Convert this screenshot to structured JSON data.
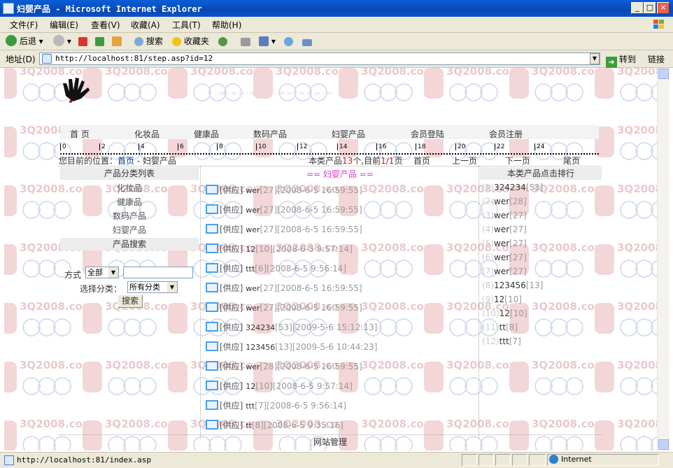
{
  "window": {
    "title": "妇婴产品 - Microsoft Internet Explorer",
    "min": "_",
    "max": "□",
    "close": "×"
  },
  "menu": [
    "文件(F)",
    "编辑(E)",
    "查看(V)",
    "收藏(A)",
    "工具(T)",
    "帮助(H)"
  ],
  "toolbar": {
    "back": "后退",
    "search": "搜索",
    "favorites": "收藏夹"
  },
  "address": {
    "label": "地址(D)",
    "url": "http://localhost:81/step.asp?id=12",
    "go": "转到",
    "links": "链接"
  },
  "watermark": "3Q2008.com",
  "nav": [
    "首 页",
    "化妆品",
    "健康品",
    "数码产品",
    "妇婴产品",
    "会员登陆",
    "会员注册"
  ],
  "ruler": [
    "0",
    "2",
    "4",
    "6",
    "8",
    "10",
    "12",
    "14",
    "16",
    "18",
    "20",
    "22",
    "24"
  ],
  "location": {
    "prefix": "您目前的位置：",
    "home": "首页",
    "current": " - 妇婴产品"
  },
  "pager": {
    "p1": "本类产品",
    "count": "13",
    "p2": "个,目前",
    "page": "1/1",
    "p3": "页",
    "first": "首页",
    "prev": "上一页",
    "next": "下一页",
    "last": "尾页"
  },
  "sidebar": {
    "title": "产品分类列表",
    "items": [
      "化妆品",
      "健康品",
      "数码产品",
      "妇婴产品"
    ],
    "search_title": "产品搜索",
    "mode_label": "方式",
    "mode_value": "全部",
    "category_label": "选择分类：",
    "category_value": "所有分类",
    "search_button": "搜索"
  },
  "main": {
    "title": "== 妇婴产品 ==",
    "rows": [
      {
        "tag": "[供应]",
        "name": "wer",
        "count": "27",
        "date": "2008-6-5 16:59:55"
      },
      {
        "tag": "[供应]",
        "name": "wer",
        "count": "27",
        "date": "2008-6-5 16:59:55"
      },
      {
        "tag": "[供应]",
        "name": "wer",
        "count": "27",
        "date": "2008-6-5 16:59:55"
      },
      {
        "tag": "[供应]",
        "name": "12",
        "count": "10",
        "date": "2008-6-5 9:57:14"
      },
      {
        "tag": "[供应]",
        "name": "ttt",
        "count": "6",
        "date": "2008-6-5 9:56:14"
      },
      {
        "tag": "[供应]",
        "name": "wer",
        "count": "27",
        "date": "2008-6-5 16:59:55"
      },
      {
        "tag": "[供应]",
        "name": "wer",
        "count": "27",
        "date": "2008-6-5 16:59:55"
      },
      {
        "tag": "[供应]",
        "name": "324234",
        "count": "53",
        "date": "2009-5-6 15:12:13"
      },
      {
        "tag": "[供应]",
        "name": "123456",
        "count": "13",
        "date": "2009-5-6 10:44:23"
      },
      {
        "tag": "[供应]",
        "name": "wer",
        "count": "28",
        "date": "2008-6-5 16:59:55"
      },
      {
        "tag": "[供应]",
        "name": "12",
        "count": "10",
        "date": "2008-6-5 9:57:14"
      },
      {
        "tag": "[供应]",
        "name": "ttt",
        "count": "7",
        "date": "2008-6-5 9:56:14"
      },
      {
        "tag": "[供应]",
        "name": "tt",
        "count": "8",
        "date": "2008-6-5 9:35:16"
      }
    ]
  },
  "ranking": {
    "title": "本类产品点击排行",
    "rows": [
      {
        "idx": "(1)",
        "name": "324234",
        "count": "53"
      },
      {
        "idx": "(2)",
        "name": "wer",
        "count": "28"
      },
      {
        "idx": "(3)",
        "name": "wer",
        "count": "27"
      },
      {
        "idx": "(4)",
        "name": "wer",
        "count": "27"
      },
      {
        "idx": "(5)",
        "name": "wer",
        "count": "27"
      },
      {
        "idx": "(6)",
        "name": "wer",
        "count": "27"
      },
      {
        "idx": "(7)",
        "name": "wer",
        "count": "27"
      },
      {
        "idx": "(8)",
        "name": "123456",
        "count": "13"
      },
      {
        "idx": "(9)",
        "name": "12",
        "count": "10"
      },
      {
        "idx": "(10)",
        "name": "12",
        "count": "10"
      },
      {
        "idx": "(11)",
        "name": "tt",
        "count": "8"
      },
      {
        "idx": "(12)",
        "name": "ttt",
        "count": "7"
      }
    ]
  },
  "footer": "网站管理",
  "status": {
    "url": "http://localhost:81/index.asp",
    "zone": "Internet"
  }
}
